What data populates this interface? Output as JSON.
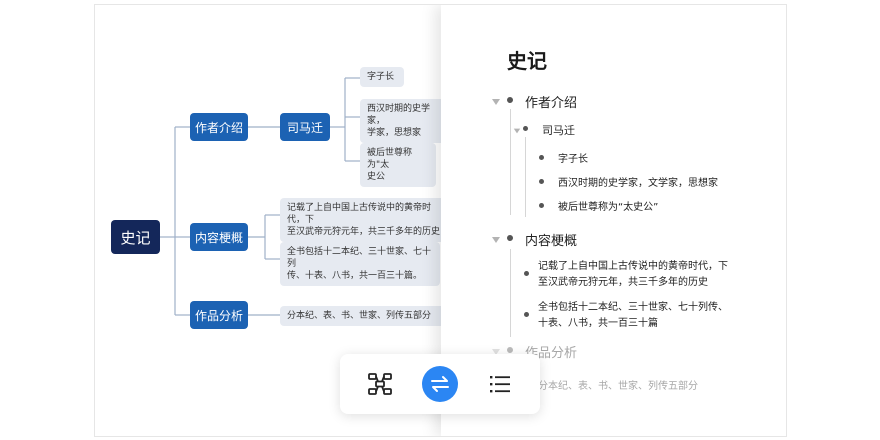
{
  "mindmap": {
    "root": "史记",
    "branches": [
      {
        "label": "作者介绍",
        "child": "司马迁",
        "leaves": [
          "字子长",
          "西汉时期的史学家，\n学家，思想家",
          "被后世尊称为\"太\n史公"
        ]
      },
      {
        "label": "内容梗概",
        "leaves": [
          "记载了上自中国上古传说中的黄帝时代，下\n至汉武帝元狩元年，共三千多年的历史",
          "全书包括十二本纪、三十世家、七十列\n传、十表、八书，共一百三十篇。"
        ]
      },
      {
        "label": "作品分析",
        "leaves": [
          "分本纪、表、书、世家、列传五部分"
        ]
      }
    ]
  },
  "outline": {
    "title": "史记",
    "s1": "作者介绍",
    "s1_child": "司马迁",
    "s1_items": [
      "字子长",
      "西汉时期的史学家，文学家，思想家",
      "被后世尊称为“太史公”"
    ],
    "s2": "内容梗概",
    "s2_items": [
      "记载了上自中国上古传说中的黄帝时代，下\n至汉武帝元狩元年，共三千多年的历史",
      "全书包括十二本纪、三十世家、七十列传、\n十表、八书，共一百三十篇"
    ],
    "s3": "作品分析",
    "s3_items": [
      "分本纪、表、书、世家、列传五部分"
    ]
  },
  "toolbar": {
    "buttons": [
      {
        "name": "mindmap-view",
        "icon": "mindmap-icon"
      },
      {
        "name": "switch-view",
        "icon": "swap-arrows-icon",
        "active": true
      },
      {
        "name": "outline-view",
        "icon": "list-icon"
      }
    ],
    "accent": "#2b86f3"
  }
}
